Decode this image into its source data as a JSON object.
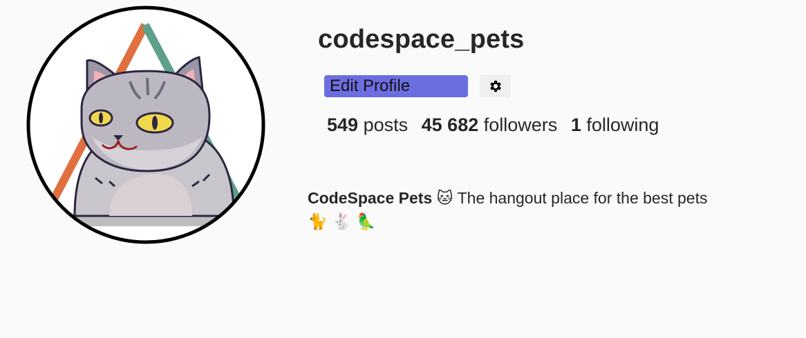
{
  "profile": {
    "username": "codespace_pets",
    "avatar_icon": "cat-avatar-icon",
    "edit_profile_label": "Edit Profile",
    "settings_icon": "gear-icon",
    "accent_color": "#6c6ee0",
    "stats": {
      "posts_count": "549",
      "posts_label": "posts",
      "followers_count": "45 682",
      "followers_label": "followers",
      "following_count": "1",
      "following_label": "following"
    },
    "bio": {
      "name": "CodeSpace Pets",
      "name_emoji": "🐱",
      "text": "The hangout place for the best pets",
      "emojis": "🐈 🐇 🦜"
    }
  }
}
